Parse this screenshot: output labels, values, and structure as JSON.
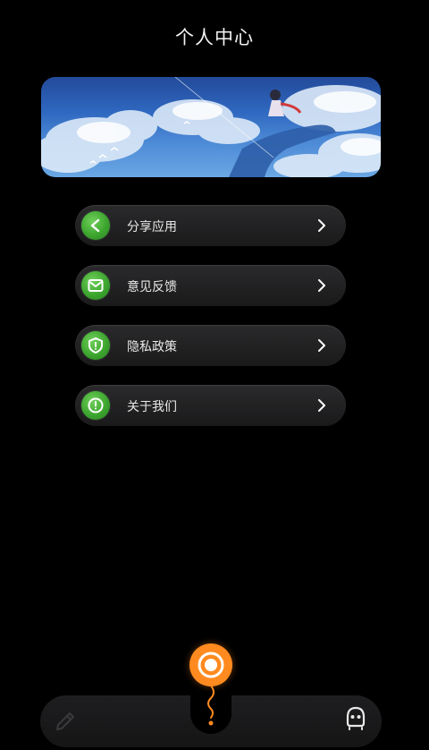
{
  "header": {
    "title": "个人中心"
  },
  "menu": [
    {
      "label": "分享应用",
      "icon": "share-icon"
    },
    {
      "label": "意见反馈",
      "icon": "mail-icon"
    },
    {
      "label": "隐私政策",
      "icon": "shield-icon"
    },
    {
      "label": "关于我们",
      "icon": "info-icon"
    }
  ],
  "tabbar": {
    "left_icon": "pencil-icon",
    "center_icon": "circle-target-icon",
    "right_icon": "robot-face-icon"
  },
  "colors": {
    "accent": "#ff8a1f",
    "icon_green": "#3da52f",
    "background": "#000000"
  }
}
